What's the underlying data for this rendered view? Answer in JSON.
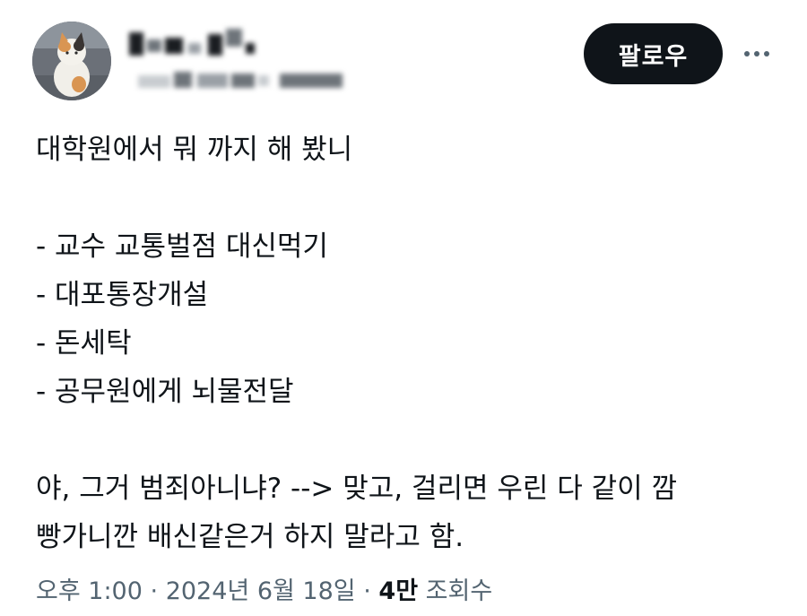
{
  "header": {
    "follow_label": "팔로우"
  },
  "tweet": {
    "lines": [
      "대학원에서 뭐 까지 해 봤니",
      "",
      "- 교수 교통벌점 대신먹기",
      "- 대포통장개설",
      "- 돈세탁",
      "- 공무원에게 뇌물전달",
      "",
      "야, 그거 범죄아니냐? --> 맞고, 걸리면 우린 다 같이 깜",
      "빵가니깐 배신같은거 하지 말라고 함."
    ]
  },
  "meta": {
    "time": "오후 1:00",
    "separator": "·",
    "date": "2024년 6월 18일",
    "views_count": "4만",
    "views_label": "조회수"
  },
  "icons": {
    "more": "more-horizontal-icon",
    "avatar": "cat-avatar"
  },
  "colors": {
    "follow_button_bg": "#0f1419",
    "text": "#0f1419",
    "secondary_text": "#536471"
  }
}
